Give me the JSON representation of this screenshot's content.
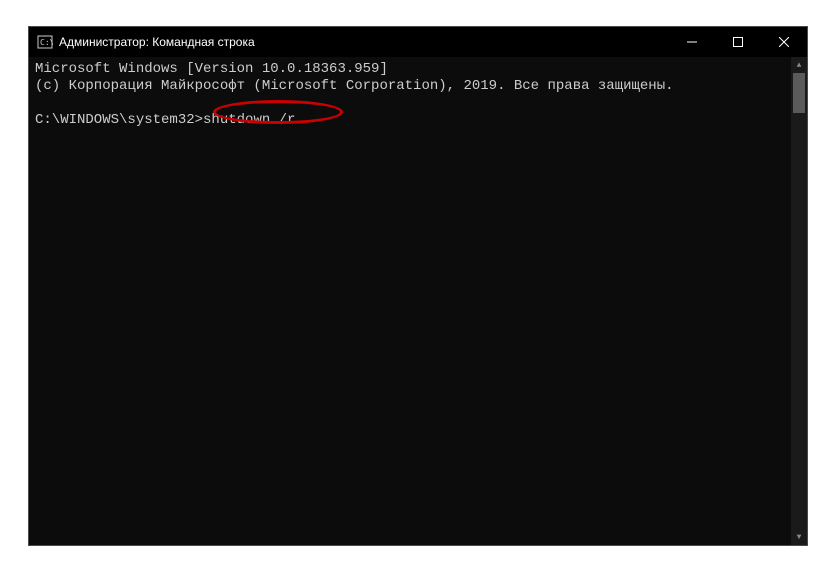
{
  "window": {
    "title": "Администратор: Командная строка"
  },
  "terminal": {
    "line1": "Microsoft Windows [Version 10.0.18363.959]",
    "line2": "(c) Корпорация Майкрософт (Microsoft Corporation), 2019. Все права защищены.",
    "prompt": "C:\\WINDOWS\\system32>",
    "command": "shutdown /r"
  },
  "highlight": {
    "color": "#cc0000"
  }
}
